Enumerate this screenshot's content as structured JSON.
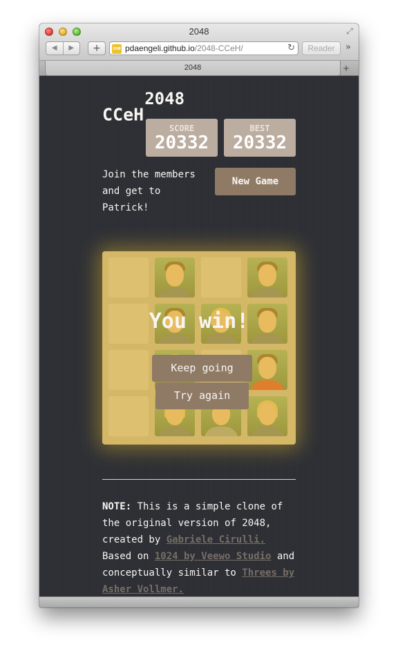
{
  "window": {
    "title": "2048",
    "url_host": "pdaengeli.github.io",
    "url_path": "/2048-CCeH/",
    "reader_label": "Reader",
    "tab_label": "2048",
    "favicon_text": "2048",
    "nav_back": "◀",
    "nav_forward": "▶",
    "add_glyph": "+",
    "reload_glyph": "↻",
    "more_glyph": "»",
    "fullscreen_glyph": "⤢",
    "newtab_glyph": "+"
  },
  "game": {
    "title": "CCeH",
    "title_sup": "2048",
    "score_label": "SCORE",
    "score_value": "20332",
    "best_label": "BEST",
    "best_value": "20332",
    "intro": "Join the members and get to Patrick!",
    "new_game_label": "New Game",
    "win_message": "You win!",
    "keep_going_label": "Keep going",
    "try_again_label": "Try again"
  },
  "board": {
    "rows": [
      [
        "empty",
        "photo",
        "empty",
        "photo"
      ],
      [
        "empty",
        "photo",
        "photo-blond",
        "photo"
      ],
      [
        "empty",
        "photo-blond",
        "empty",
        "photo-red"
      ],
      [
        "empty",
        "photo-blond",
        "photo-grey",
        "photo-blond"
      ]
    ]
  },
  "note": {
    "label": "NOTE:",
    "text1": " This is a simple clone of the original version of 2048, created by ",
    "link1": "Gabriele Cirulli.",
    "text2": " Based on ",
    "link2": "1024 by Veewo Studio",
    "text3": " and conceptually similar to ",
    "link3": "Threes by Asher Vollmer."
  },
  "colors": {
    "background": "#2c2e34",
    "board": "#bbada0",
    "button": "#8f7a66",
    "win_overlay": "#edc22e",
    "link": "#776e65"
  }
}
